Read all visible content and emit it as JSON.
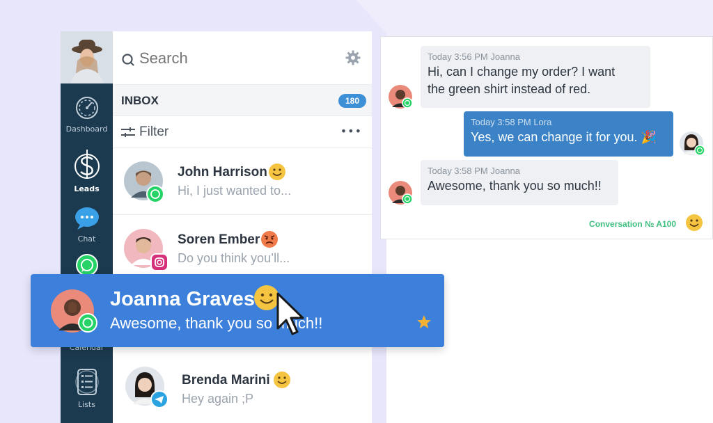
{
  "search": {
    "placeholder": "Search"
  },
  "sidebar": {
    "items": [
      {
        "label": "Dashboard",
        "icon": "dashboard-gauge-icon"
      },
      {
        "label": "Leads",
        "icon": "dollar-icon"
      },
      {
        "label": "Chat",
        "icon": "chat-bubble-icon"
      },
      {
        "label": "Calendar",
        "icon": "calendar-icon"
      },
      {
        "label": "Lists",
        "icon": "list-icon"
      }
    ],
    "whatsapp_icon": "whatsapp-icon"
  },
  "inbox": {
    "title": "INBOX",
    "count": "180",
    "filter_label": "Filter",
    "more_label": "•••"
  },
  "conversations": [
    {
      "name": "John Harrison",
      "preview": "Hi, I just wanted to...",
      "emoji": "smile",
      "channel": "whatsapp"
    },
    {
      "name": "Soren Ember",
      "preview": "Do you think you’ll...",
      "emoji": "angry",
      "channel": "instagram"
    },
    {
      "name": "Joanna Graves",
      "preview": "Awesome, thank you so much!!",
      "emoji": "smile",
      "channel": "whatsapp",
      "selected": true,
      "starred": true
    },
    {
      "name": "Brenda Marini",
      "preview": "Hey again ;P",
      "emoji": "smile",
      "channel": "telegram"
    }
  ],
  "chat": {
    "messages": [
      {
        "meta": "Today 3:56 PM Joanna",
        "lines": [
          "Hi, can I change my order? I want",
          "the green shirt instead of red."
        ],
        "direction": "in"
      },
      {
        "meta": "Today 3:58 PM Lora",
        "lines": [
          "Yes,  we can change it for you. 🎉"
        ],
        "direction": "out"
      },
      {
        "meta": "Today 3:58 PM Joanna",
        "lines": [
          "Awesome, thank you so much!!"
        ],
        "direction": "in"
      }
    ],
    "conversation_number": "Conversation № A100"
  },
  "colors": {
    "sidebar": "#1c3a4f",
    "accent": "#3d80dc",
    "badge": "#3d8fd6",
    "whatsapp": "#25d366",
    "conversation_number": "#3fbf7f"
  }
}
